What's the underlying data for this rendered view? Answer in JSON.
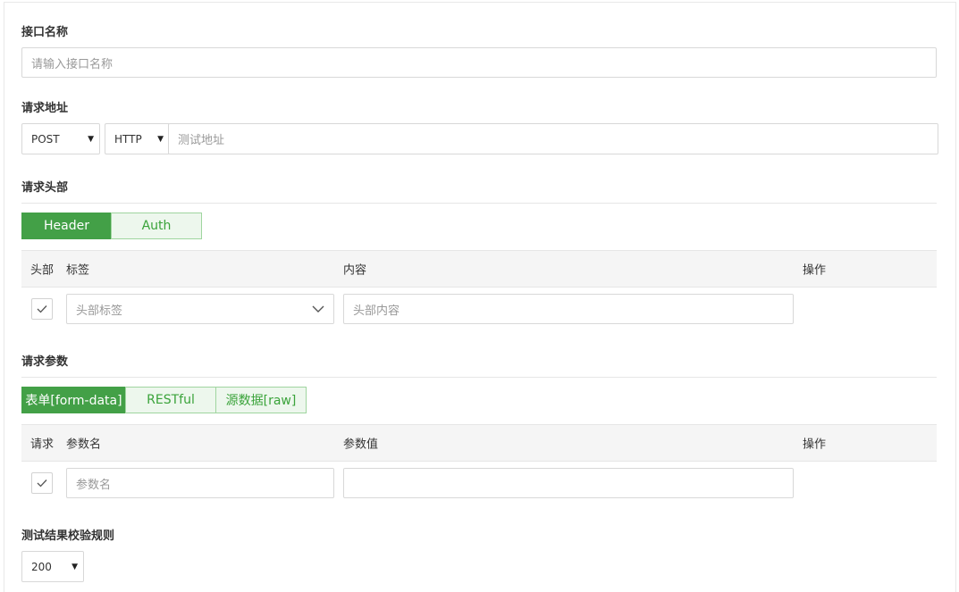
{
  "interface_name": {
    "label": "接口名称",
    "placeholder": "请输入接口名称"
  },
  "request_url": {
    "label": "请求地址",
    "method": "POST",
    "protocol": "HTTP",
    "url_placeholder": "测试地址"
  },
  "headers": {
    "label": "请求头部",
    "tabs": [
      "Header",
      "Auth"
    ],
    "active_tab": "Header",
    "columns": [
      "头部",
      "标签",
      "内容",
      "操作"
    ],
    "row": {
      "checked": true,
      "tag_placeholder": "头部标签",
      "content_placeholder": "头部内容"
    }
  },
  "params": {
    "label": "请求参数",
    "tabs": [
      "表单[form-data]",
      "RESTful",
      "源数据[raw]"
    ],
    "active_tab": "表单[form-data]",
    "columns": [
      "请求",
      "参数名",
      "参数值",
      "操作"
    ],
    "row": {
      "checked": true,
      "name_placeholder": "参数名",
      "value": ""
    }
  },
  "validation": {
    "label": "测试结果校验规则",
    "status_code": "200"
  },
  "colors": {
    "accent": "#43a047",
    "tab_inactive_bg": "#edf7ed",
    "border": "#d8d8d8"
  }
}
